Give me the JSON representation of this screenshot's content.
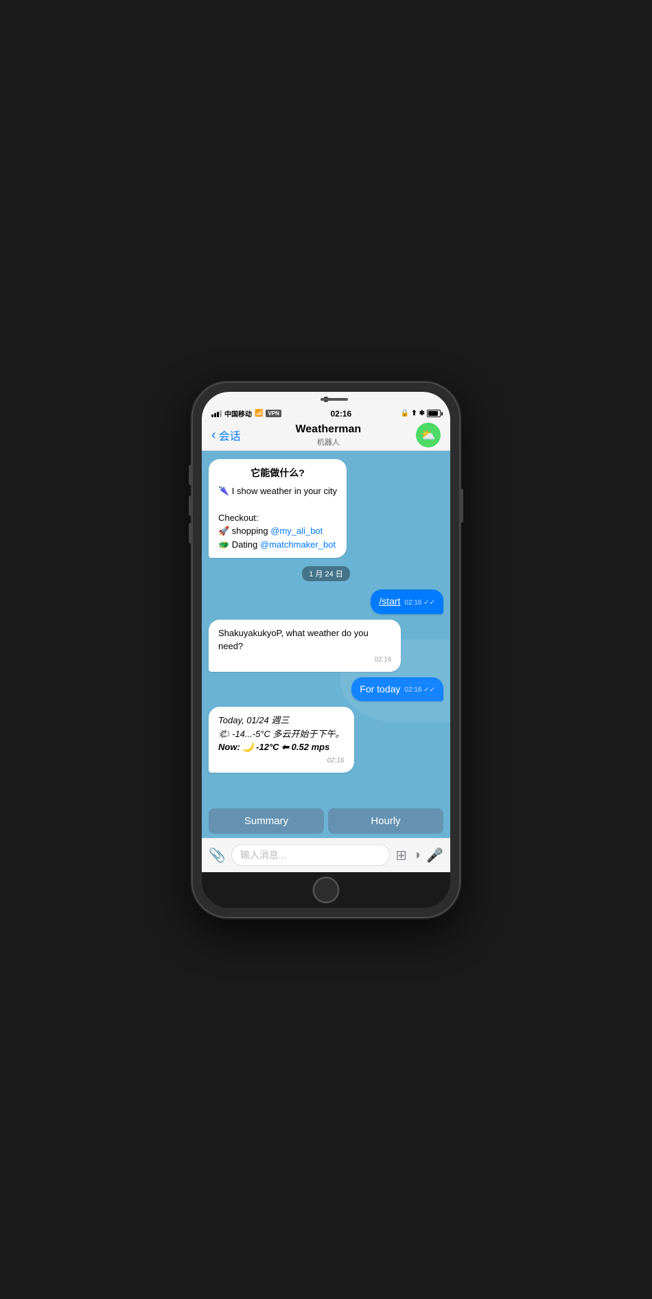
{
  "status_bar": {
    "carrier": "中国移动",
    "wifi": "WiFi",
    "vpn": "VPN",
    "time": "02:16",
    "battery": "100"
  },
  "nav": {
    "back_label": "会话",
    "title": "Weatherman",
    "subtitle": "机器人",
    "icon": "☁️"
  },
  "chat": {
    "bot_intro": {
      "title": "它能做什么?",
      "line1": "🌂 I show weather in your city",
      "checkout": "Checkout:",
      "shopping": "🚀 shopping",
      "shopping_link": "@my_ali_bot",
      "dating": "🐲 Dating",
      "dating_link": "@matchmaker_bot"
    },
    "date_sep": "1 月 24 日",
    "msg_start": {
      "text": "/start",
      "time": "02:16",
      "ticks": "✓✓"
    },
    "msg_question": {
      "text": "ShakuyakukyoP, what weather do you need?",
      "time": "02:16"
    },
    "msg_for_today": {
      "text": "For today",
      "time": "02:16",
      "ticks": "✓✓"
    },
    "msg_weather": {
      "line1": "Today, 01/24 週三",
      "line2": "🌤 -14...-5°C 多云开始于下午。",
      "line3": "Now: 🌙 -12°C ⬅ 0.52 mps",
      "time": "02:16"
    }
  },
  "buttons": {
    "summary": "Summary",
    "hourly": "Hourly"
  },
  "input": {
    "placeholder": "输入消息..."
  }
}
